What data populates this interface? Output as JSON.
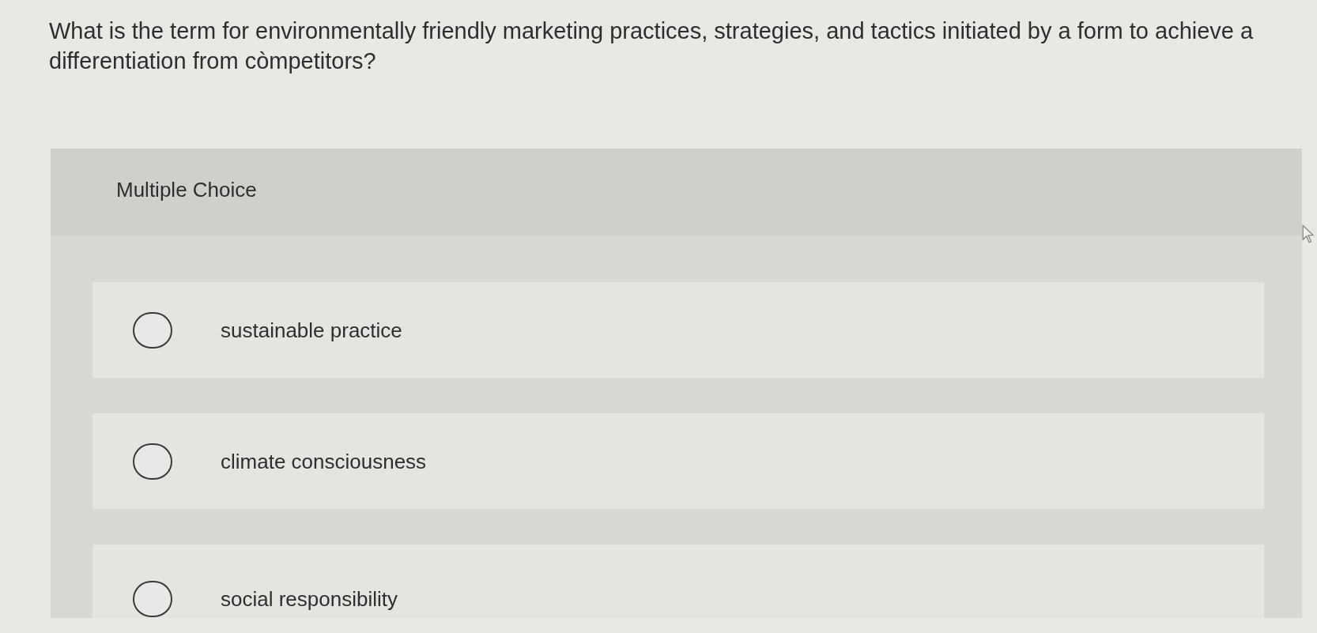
{
  "question": "What is the term for environmentally friendly marketing practices, strategies, and tactics initiated by a form to achieve a differentiation from còmpetitors?",
  "panel": {
    "heading": "Multiple Choice"
  },
  "options": [
    {
      "label": "sustainable practice",
      "selected": false
    },
    {
      "label": "climate consciousness",
      "selected": false
    },
    {
      "label": "social responsibility",
      "selected": false
    }
  ]
}
